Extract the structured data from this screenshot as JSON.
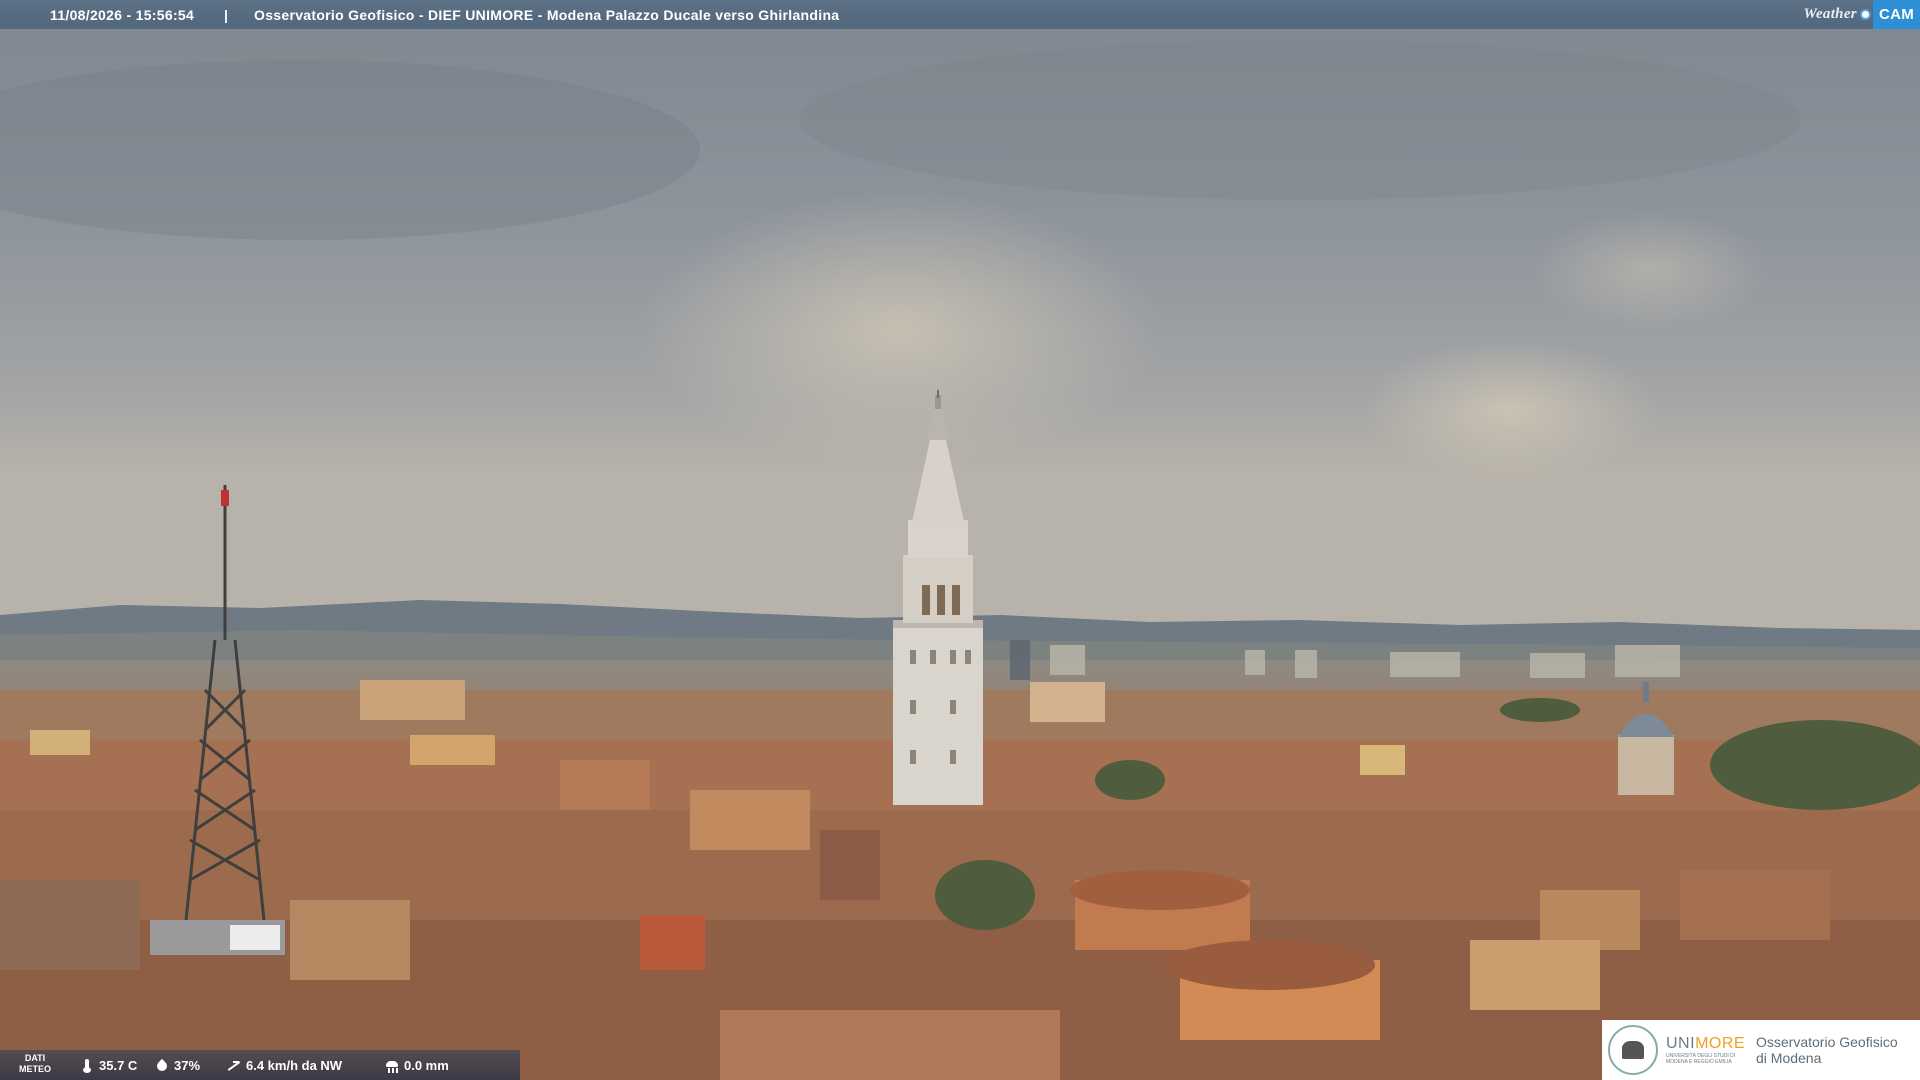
{
  "header": {
    "timestamp": "11/08/2026 - 15:56:54",
    "separator": "|",
    "title": "Osservatorio Geofisico - DIEF UNIMORE - Modena Palazzo Ducale verso Ghirlandina",
    "logo_weather": "Weather",
    "logo_cam": "CAM"
  },
  "meteo": {
    "label_line1": "DATI",
    "label_line2": "METEO",
    "temperature": "35.7 C",
    "humidity": "37%",
    "wind": "6.4 km/h da NW",
    "rain": "0.0 mm"
  },
  "branding": {
    "uni_name_a": "UNI",
    "uni_name_b": "MORE",
    "uni_sub1": "UNIVERSITÀ DEGLI STUDI DI",
    "uni_sub2": "MODENA E REGGIO EMILIA",
    "obs_line1": "Osservatorio Geofisico",
    "obs_line2": "di Modena"
  },
  "colors": {
    "bar": "#5d7186",
    "cam_blue": "#2e8fd6",
    "unimore_orange": "#f0a020",
    "sky": "#8d9299",
    "roofs": "#a8785a"
  },
  "icons": [
    "thermometer-icon",
    "humidity-icon",
    "wind-icon",
    "rain-icon",
    "unimore-seal-icon"
  ]
}
